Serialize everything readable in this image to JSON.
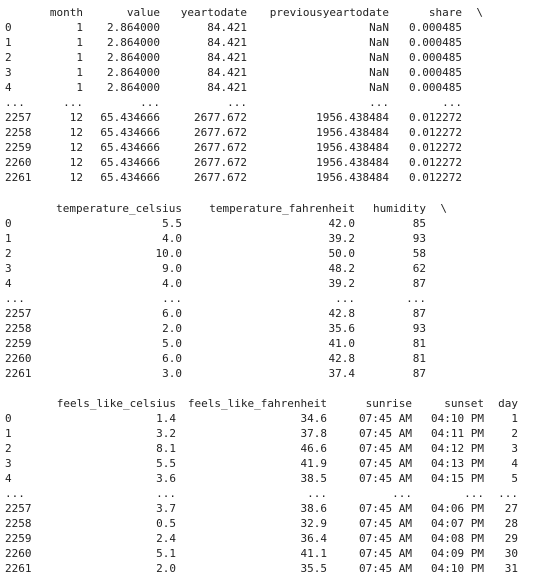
{
  "table1": {
    "headers": [
      "month",
      "value",
      "yeartodate",
      "previousyeartodate",
      "share",
      "\\"
    ],
    "rows": [
      [
        "0",
        "1",
        "2.864000",
        "84.421",
        "NaN",
        "0.000485"
      ],
      [
        "1",
        "1",
        "2.864000",
        "84.421",
        "NaN",
        "0.000485"
      ],
      [
        "2",
        "1",
        "2.864000",
        "84.421",
        "NaN",
        "0.000485"
      ],
      [
        "3",
        "1",
        "2.864000",
        "84.421",
        "NaN",
        "0.000485"
      ],
      [
        "4",
        "1",
        "2.864000",
        "84.421",
        "NaN",
        "0.000485"
      ],
      [
        "...",
        "...",
        "...",
        "...",
        "...",
        "..."
      ],
      [
        "2257",
        "12",
        "65.434666",
        "2677.672",
        "1956.438484",
        "0.012272"
      ],
      [
        "2258",
        "12",
        "65.434666",
        "2677.672",
        "1956.438484",
        "0.012272"
      ],
      [
        "2259",
        "12",
        "65.434666",
        "2677.672",
        "1956.438484",
        "0.012272"
      ],
      [
        "2260",
        "12",
        "65.434666",
        "2677.672",
        "1956.438484",
        "0.012272"
      ],
      [
        "2261",
        "12",
        "65.434666",
        "2677.672",
        "1956.438484",
        "0.012272"
      ]
    ]
  },
  "table2": {
    "headers": [
      "temperature_celsius",
      "temperature_fahrenheit",
      "humidity",
      "\\"
    ],
    "rows": [
      [
        "0",
        "5.5",
        "42.0",
        "85"
      ],
      [
        "1",
        "4.0",
        "39.2",
        "93"
      ],
      [
        "2",
        "10.0",
        "50.0",
        "58"
      ],
      [
        "3",
        "9.0",
        "48.2",
        "62"
      ],
      [
        "4",
        "4.0",
        "39.2",
        "87"
      ],
      [
        "...",
        "...",
        "...",
        "..."
      ],
      [
        "2257",
        "6.0",
        "42.8",
        "87"
      ],
      [
        "2258",
        "2.0",
        "35.6",
        "93"
      ],
      [
        "2259",
        "5.0",
        "41.0",
        "81"
      ],
      [
        "2260",
        "6.0",
        "42.8",
        "81"
      ],
      [
        "2261",
        "3.0",
        "37.4",
        "87"
      ]
    ]
  },
  "table3": {
    "headers": [
      "feels_like_celsius",
      "feels_like_fahrenheit",
      "sunrise",
      "sunset",
      "day"
    ],
    "rows": [
      [
        "0",
        "1.4",
        "34.6",
        "07:45 AM",
        "04:10 PM",
        "1"
      ],
      [
        "1",
        "3.2",
        "37.8",
        "07:45 AM",
        "04:11 PM",
        "2"
      ],
      [
        "2",
        "8.1",
        "46.6",
        "07:45 AM",
        "04:12 PM",
        "3"
      ],
      [
        "3",
        "5.5",
        "41.9",
        "07:45 AM",
        "04:13 PM",
        "4"
      ],
      [
        "4",
        "3.6",
        "38.5",
        "07:45 AM",
        "04:15 PM",
        "5"
      ],
      [
        "...",
        "...",
        "...",
        "...",
        "...",
        "..."
      ],
      [
        "2257",
        "3.7",
        "38.6",
        "07:45 AM",
        "04:06 PM",
        "27"
      ],
      [
        "2258",
        "0.5",
        "32.9",
        "07:45 AM",
        "04:07 PM",
        "28"
      ],
      [
        "2259",
        "2.4",
        "36.4",
        "07:45 AM",
        "04:08 PM",
        "29"
      ],
      [
        "2260",
        "5.1",
        "41.1",
        "07:45 AM",
        "04:09 PM",
        "30"
      ],
      [
        "2261",
        "2.0",
        "35.5",
        "07:45 AM",
        "04:10 PM",
        "31"
      ]
    ]
  }
}
